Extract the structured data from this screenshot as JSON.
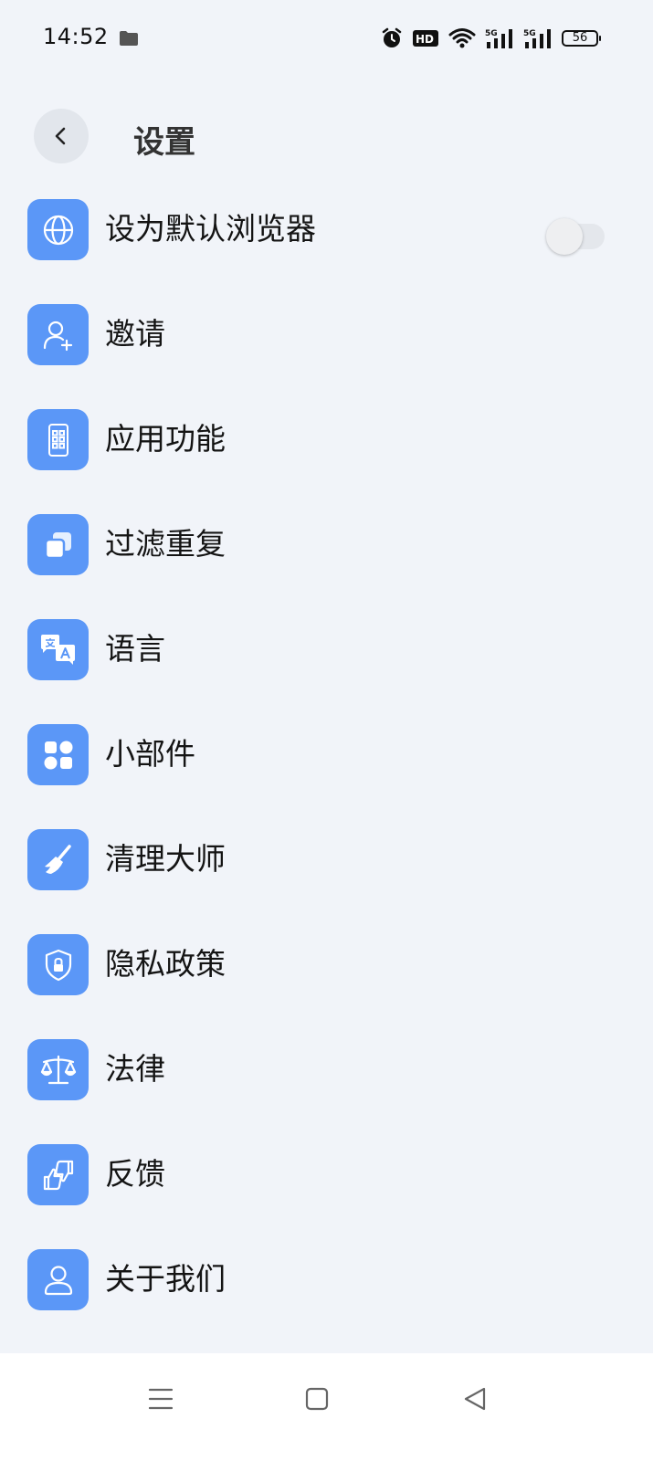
{
  "status_bar": {
    "time": "14:52",
    "icons": [
      "folder-icon",
      "alarm-icon",
      "hd-icon",
      "wifi-icon",
      "signal-5g-icon",
      "signal-5g-icon"
    ],
    "hd_label": "HD",
    "network_label_1": "5G",
    "network_label_2": "5G",
    "battery_level": "56"
  },
  "header": {
    "title": "设置",
    "back_icon": "chevron-left-icon"
  },
  "menu": {
    "items": [
      {
        "label": "设为默认浏览器",
        "icon": "globe-icon",
        "toggle": false
      },
      {
        "label": "邀请",
        "icon": "add-user-icon"
      },
      {
        "label": "应用功能",
        "icon": "phone-apps-icon"
      },
      {
        "label": "过滤重复",
        "icon": "duplicate-icon"
      },
      {
        "label": "语言",
        "icon": "translate-icon"
      },
      {
        "label": "小部件",
        "icon": "widgets-icon"
      },
      {
        "label": "清理大师",
        "icon": "broom-icon"
      },
      {
        "label": "隐私政策",
        "icon": "shield-lock-icon"
      },
      {
        "label": "法律",
        "icon": "scales-icon"
      },
      {
        "label": "反馈",
        "icon": "thumbs-icon"
      },
      {
        "label": "关于我们",
        "icon": "person-icon"
      }
    ]
  },
  "nav_bar": {
    "buttons": [
      "menu-icon",
      "home-square-icon",
      "back-triangle-icon"
    ]
  },
  "colors": {
    "background": "#f1f4f9",
    "icon_tile": "#5b97f7",
    "nav_bar": "#ffffff"
  }
}
